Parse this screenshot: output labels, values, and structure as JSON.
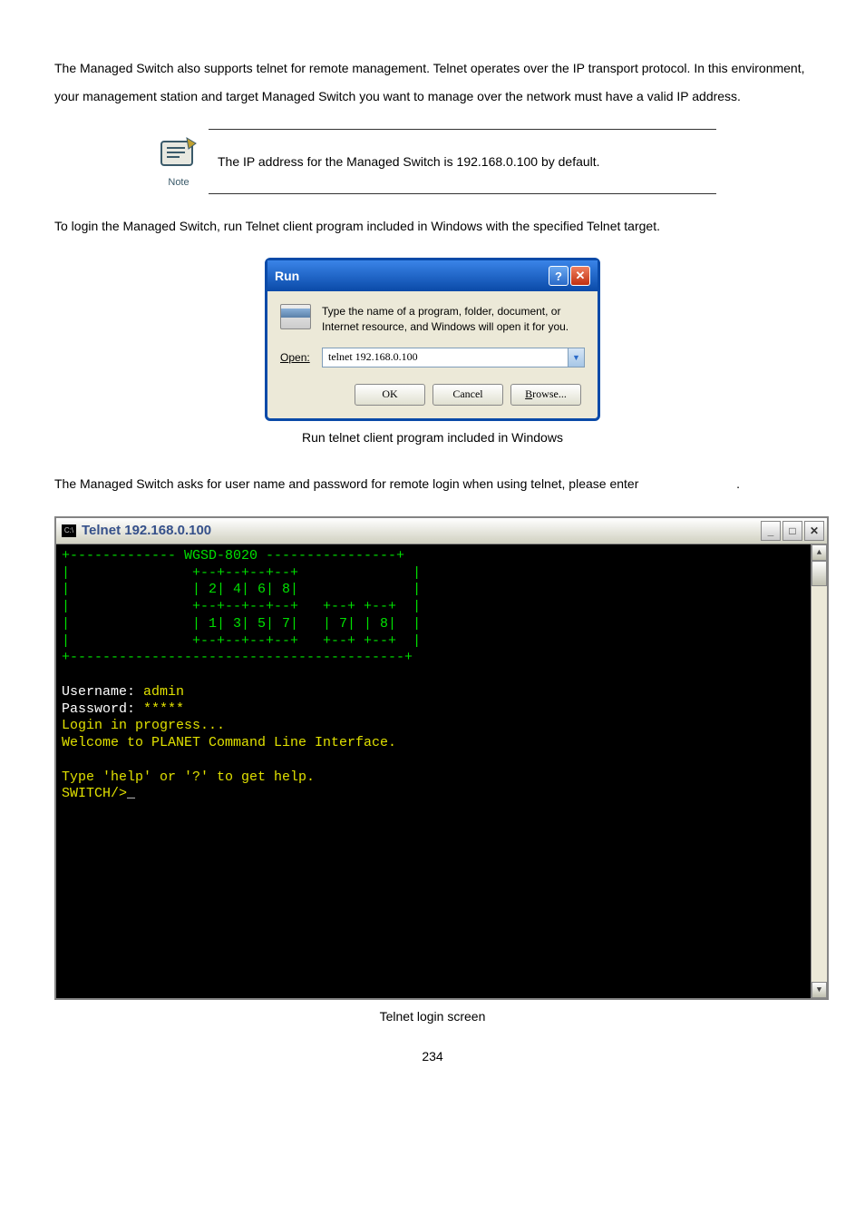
{
  "intro_paragraph": "The Managed Switch also supports telnet for remote management. Telnet operates over the IP transport protocol. In this environment, your management station and target Managed Switch you want to manage over the network must have a valid IP address.",
  "note": {
    "label": "Note",
    "text": "The IP address for the Managed Switch is 192.168.0.100 by default."
  },
  "login_paragraph": "To login the Managed Switch, run Telnet client program included in Windows with the specified Telnet target.",
  "run_dialog": {
    "title": "Run",
    "instruction": "Type the name of a program, folder, document, or Internet resource, and Windows will open it for you.",
    "open_label_letter": "O",
    "open_label_rest": "pen:",
    "input_value": "telnet 192.168.0.100",
    "buttons": {
      "ok": "OK",
      "cancel": "Cancel",
      "browse_letter": "B",
      "browse_rest": "rowse..."
    }
  },
  "caption_run": "Run telnet client program included in Windows",
  "asks_paragraph": "The Managed Switch asks for user name and password for remote login when using telnet, please enter",
  "asks_trailing": ".",
  "telnet_window": {
    "title": "Telnet 192.168.0.100",
    "cmd_label": "C:\\",
    "ascii_header": "+------------- WGSD-8020 ----------------+",
    "ascii_l1": "|               +--+--+--+--+              |",
    "ascii_l2": "|               | 2| 4| 6| 8|              |",
    "ascii_l3": "|               +--+--+--+--+   +--+ +--+  |",
    "ascii_l4": "|               | 1| 3| 5| 7|   | 7| | 8|  |",
    "ascii_l5": "|               +--+--+--+--+   +--+ +--+  |",
    "ascii_footer": "+-----------------------------------------+",
    "user_label": "Username: ",
    "user_value": "admin",
    "pass_label": "Password: ",
    "pass_value": "*****",
    "login_progress": "Login in progress...",
    "welcome": "Welcome to PLANET Command Line Interface.",
    "help_line": "Type 'help' or '?' to get help.",
    "prompt": "SWITCH/>",
    "cursor": "_"
  },
  "caption_telnet": "Telnet login screen",
  "page_number": "234"
}
